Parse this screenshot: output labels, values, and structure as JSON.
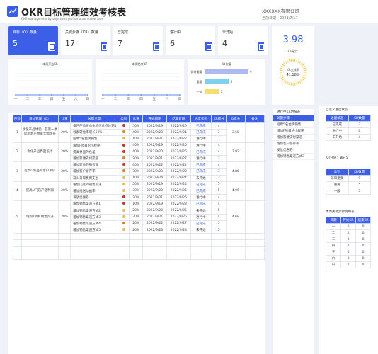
{
  "header": {
    "title": "OKR目标管理绩效考核表",
    "subtitle": "OKR management by objectives performance review form",
    "company": "XXXXXX有限公司",
    "date": "当前日期：2023/7/17"
  },
  "kpis": [
    {
      "label": "目标（O）数量",
      "value": "5"
    },
    {
      "label": "关键步骤（KR）数量",
      "value": "17"
    },
    {
      "label": "已完成",
      "value": "7"
    },
    {
      "label": "进行中",
      "value": "6"
    },
    {
      "label": "未开始",
      "value": "4"
    }
  ],
  "score": {
    "value": "3.98",
    "label": "O得分",
    "gauge_title": "KR完成率",
    "gauge_value": "41.18%",
    "gauge_fraction": 0.4118
  },
  "charts": {
    "chart1": {
      "title": "本周开始KR",
      "categories": [
        "一",
        "二",
        "三",
        "四",
        "五",
        "六",
        "日"
      ],
      "values": [
        0,
        0,
        0,
        0,
        0,
        0,
        0
      ]
    },
    "chart2": {
      "title": "本周结束KR",
      "categories": [
        "一",
        "二",
        "三",
        "四",
        "五",
        "六",
        "日"
      ],
      "values": [
        0,
        0,
        0,
        0,
        0,
        0,
        0
      ]
    },
    "chart3": {
      "title": "KR分值",
      "categories": [
        "非常重要",
        "重要",
        "一般"
      ],
      "values": [
        9,
        5,
        3
      ],
      "colors": [
        "#aeb8f2",
        "#7fd0f0",
        "#f7dc6f"
      ]
    }
  },
  "table": {
    "headers": [
      "序号",
      "目标管理（O）",
      "比重",
      "关键步骤",
      "类别",
      "比重",
      "开始日期",
      "结束日期",
      "进度状态",
      "KR得分",
      "O得分",
      "备注"
    ],
    "groups": [
      {
        "no": "1",
        "objective": "优化产品体验，在第一季度新客户数量大幅增长",
        "weight": "20%",
        "o_score": "3.58",
        "rows": [
          {
            "task": "每月产品核心体验优化点达到5个",
            "color": "#c0392b",
            "w": "50%",
            "start": "2022/9/19",
            "end": "2022/9/20",
            "status": "已完成",
            "kr": "4"
          },
          {
            "task": "线索转化率增长50%",
            "color": "#e67e22",
            "w": "40%",
            "start": "2022/9/20",
            "end": "2022/9/21",
            "status": "已完成",
            "kr": "3"
          },
          {
            "task": "招聘5名金牌销售",
            "color": "#e8b95a",
            "w": "10%",
            "start": "2022/9/21",
            "end": "2022/9/22",
            "status": "进行中",
            "kr": "1"
          }
        ]
      },
      {
        "no": "2",
        "objective": "优化产品界面设计",
        "weight": "20%",
        "o_score": "3.92",
        "rows": [
          {
            "task": "增加F项目的小程序",
            "color": "#c0392b",
            "w": "40%",
            "start": "2022/9/19",
            "end": "2022/9/25",
            "status": "进行中",
            "kr": "4"
          },
          {
            "task": "提高界面的色差",
            "color": "#c0392b",
            "w": "40%",
            "start": "2022/9/20",
            "end": "2022/9/26",
            "status": "已完成",
            "kr": "4"
          },
          {
            "task": "增加簇便支付渠道",
            "color": "#e67e22",
            "w": "20%",
            "start": "2022/9/21",
            "end": "2022/9/27",
            "status": "进行中",
            "kr": "3"
          }
        ]
      },
      {
        "no": "3",
        "objective": "提高G新品的客户单价",
        "weight": "20%",
        "o_score": "4.86",
        "rows": [
          {
            "task": "增加新品的销售额",
            "color": "#c0392b",
            "w": "60%",
            "start": "2022/9/22",
            "end": "2022/9/22",
            "status": "已完成",
            "kr": "4"
          },
          {
            "task": "增加客户留存率",
            "color": "#e67e22",
            "w": "30%",
            "start": "2022/9/23",
            "end": "2022/9/23",
            "status": "已完成",
            "kr": "3"
          },
          {
            "task": "减少日常费用支出",
            "color": "#e8b95a",
            "w": "10%",
            "start": "2022/9/24",
            "end": "2022/9/24",
            "status": "未开始",
            "kr": "2"
          }
        ]
      },
      {
        "no": "4",
        "objective": "提高U门店产品利润",
        "weight": "20%",
        "o_score": "4.96",
        "rows": [
          {
            "task": "增加门店的销售渠道",
            "color": "#e8b95a",
            "w": "50%",
            "start": "2022/9/19",
            "end": "2022/9/24",
            "status": "已完成",
            "kr": "5"
          },
          {
            "task": "增加推送动画率",
            "color": "#e8b95a",
            "w": "30%",
            "start": "2022/9/20",
            "end": "2022/9/25",
            "status": "已完成",
            "kr": "5"
          },
          {
            "task": "发放优惠券",
            "color": "#c0392b",
            "w": "20%",
            "start": "2022/9/21",
            "end": "2022/9/26",
            "status": "进行中",
            "kr": "4"
          }
        ]
      },
      {
        "no": "5",
        "objective": "增加Y项目销售渠道",
        "weight": "20%",
        "o_score": "4.68",
        "rows": [
          {
            "task": "增加销售渠道方式1",
            "color": "#c0392b",
            "w": "10%",
            "start": "2022/9/19",
            "end": "2022/9/23",
            "status": "已完成",
            "kr": "4"
          },
          {
            "task": "增加销售渠道方式2",
            "color": "#e8b95a",
            "w": "20%",
            "start": "2022/9/20",
            "end": "2022/9/25",
            "status": "未开始",
            "kr": "5"
          },
          {
            "task": "增加销售渠道方式3",
            "color": "#e8b95a",
            "w": "30%",
            "start": "2022/9/21",
            "end": "2022/9/26",
            "status": "进行中",
            "kr": "4"
          },
          {
            "task": "增加销售渠道方式4",
            "color": "#e67e22",
            "w": "20%",
            "start": "2022/9/22",
            "end": "2022/9/27",
            "status": "已完成",
            "kr": "5"
          },
          {
            "task": "增加销售渠道方式5",
            "color": "#e8b95a",
            "w": "20%",
            "start": "2022/9/23",
            "end": "2022/9/28",
            "status": "未开始",
            "kr": "5"
          }
        ]
      }
    ],
    "empty_rows": 4
  },
  "in_progress": {
    "title": "进行中KR明细表",
    "head": "关键步骤",
    "items": [
      "招聘5名金牌销售",
      "增加F项目的小程序",
      "增加簇便支付渠道",
      "增加客户留存率",
      "发放优惠券",
      "增加销售渠道方式3"
    ]
  },
  "right": {
    "status_title": "自定义进度状态",
    "status_headers": [
      "进度状态",
      "KR数量"
    ],
    "status_rows": [
      [
        "已完成",
        "7"
      ],
      [
        "进行中",
        "6"
      ],
      [
        "未开始",
        "4"
      ]
    ],
    "score_title": "KR分值",
    "score_summary": "KR分值：满分5",
    "score_headers": [
      "类别",
      "KR数量"
    ],
    "score_rows": [
      [
        "非常重要",
        "9"
      ],
      [
        "重要",
        "5"
      ],
      [
        "一般",
        "3"
      ]
    ],
    "week_title": "本周关键步骤明细表",
    "week_headers": [
      "日期",
      "开始KR",
      "结束KR"
    ],
    "week_rows": [
      [
        "一",
        "0",
        "0"
      ],
      [
        "二",
        "0",
        "0"
      ],
      [
        "三",
        "0",
        "0"
      ],
      [
        "四",
        "0",
        "0"
      ],
      [
        "五",
        "0",
        "0"
      ],
      [
        "六",
        "0",
        "0"
      ],
      [
        "日",
        "0",
        "0"
      ]
    ]
  }
}
